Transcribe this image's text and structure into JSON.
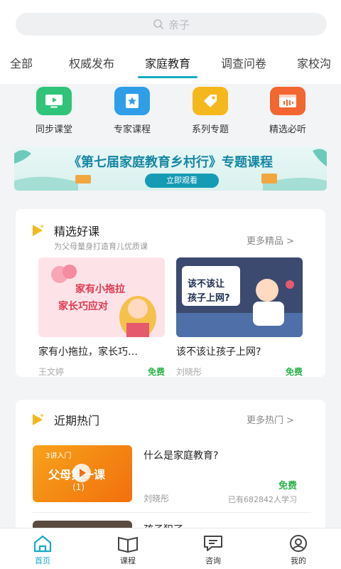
{
  "search": {
    "placeholder": "亲子"
  },
  "tabs": [
    {
      "label": "全部"
    },
    {
      "label": "权威发布"
    },
    {
      "label": "家庭教育",
      "active": true
    },
    {
      "label": "调查问卷"
    },
    {
      "label": "家校沟"
    }
  ],
  "quick_entries": [
    {
      "label": "同步课堂",
      "icon": "play-screen-icon",
      "color": "#2fc47a"
    },
    {
      "label": "专家课程",
      "icon": "star-badge-icon",
      "color": "#2f9de8"
    },
    {
      "label": "系列专题",
      "icon": "tag-icon",
      "color": "#f5b81c"
    },
    {
      "label": "精选必听",
      "icon": "audio-window-icon",
      "color": "#f2662f"
    }
  ],
  "banner": {
    "title": "《第七届家庭教育乡村行》专题课程",
    "button": "立即观看"
  },
  "featured": {
    "title": "精选好课",
    "subtitle": "为父母量身打造育儿优质课",
    "more": "更多精品 >",
    "courses": [
      {
        "title": "家有小拖拉，家长巧…",
        "author": "王文婷",
        "price": "免费",
        "thumb_text_1": "家有小拖拉",
        "thumb_text_2": "家长巧应对"
      },
      {
        "title": "该不该让孩子上网?",
        "author": "刘晓彤",
        "price": "免费",
        "thumb_text_1": "该不该让",
        "thumb_text_2": "孩子上网?"
      }
    ]
  },
  "hot": {
    "title": "近期热门",
    "more": "更多热门 >",
    "items": [
      {
        "title": "什么是家庭教育?",
        "author": "刘晓彤",
        "price": "免费",
        "learners": "已有682842人学习",
        "thumb_top": "3讲入门",
        "thumb_main": "父母第一课",
        "thumb_num": "(1)"
      },
      {
        "title": "孩子犯了..."
      }
    ]
  },
  "bottom_nav": [
    {
      "label": "首页",
      "icon": "home-icon",
      "active": true
    },
    {
      "label": "课程",
      "icon": "book-icon"
    },
    {
      "label": "咨询",
      "icon": "chat-icon"
    },
    {
      "label": "我的",
      "icon": "user-icon"
    }
  ],
  "colors": {
    "accent": "#17a9c7",
    "free": "#2ab34a"
  }
}
